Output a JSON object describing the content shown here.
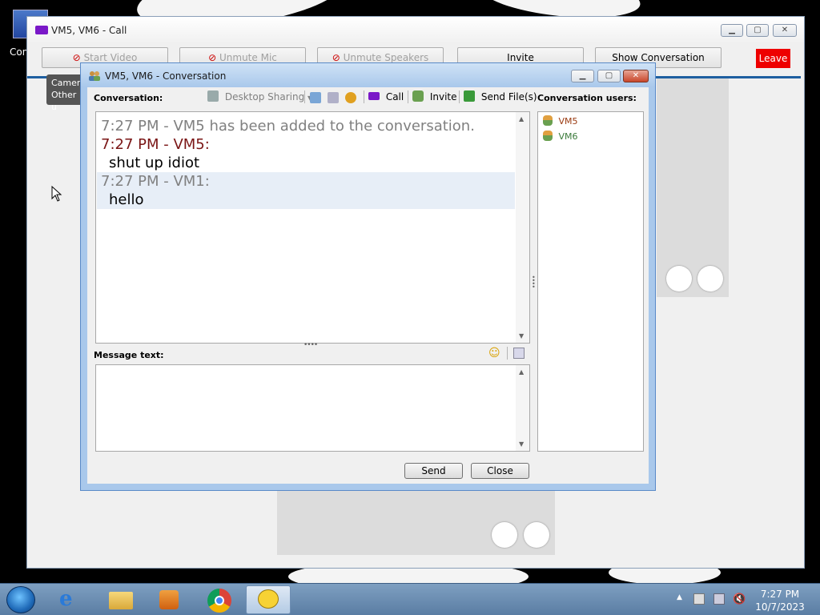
{
  "desktop": {
    "icon_label": "Con"
  },
  "call_window": {
    "title": "VM5, VM6 - Call",
    "buttons": {
      "start_video": "Start Video",
      "unmute_mic": "Unmute Mic",
      "unmute_speakers": "Unmute Speakers",
      "invite": "Invite",
      "show_conversation": "Show Conversation",
      "leave": "Leave"
    },
    "tooltip_lines": [
      "Camera",
      "Other u"
    ]
  },
  "conversation_window": {
    "title": "VM5, VM6 - Conversation",
    "conversation_label": "Conversation:",
    "toolbar": {
      "desktop_sharing": "Desktop Sharing",
      "call": "Call",
      "invite": "Invite",
      "send_files": "Send File(s)"
    },
    "messages": [
      {
        "text": "7:27 PM - VM5 has been added to the conversation.",
        "color": "#808080"
      },
      {
        "text": "7:27 PM - VM5:",
        "color": "#7a1515"
      },
      {
        "text": "shut up idiot",
        "color": "#000000"
      },
      {
        "text": "7:27 PM - VM1:",
        "color": "#808080"
      },
      {
        "text": "hello",
        "color": "#000000"
      }
    ],
    "users_label": "Conversation users:",
    "users": [
      {
        "name": "VM5",
        "color": "#9a3a10"
      },
      {
        "name": "VM6",
        "color": "#3a7a3a"
      }
    ],
    "message_text_label": "Message text:",
    "message_input_value": "",
    "send_label": "Send",
    "close_label": "Close"
  },
  "taskbar": {
    "time": "7:27 PM",
    "date": "10/7/2023"
  }
}
